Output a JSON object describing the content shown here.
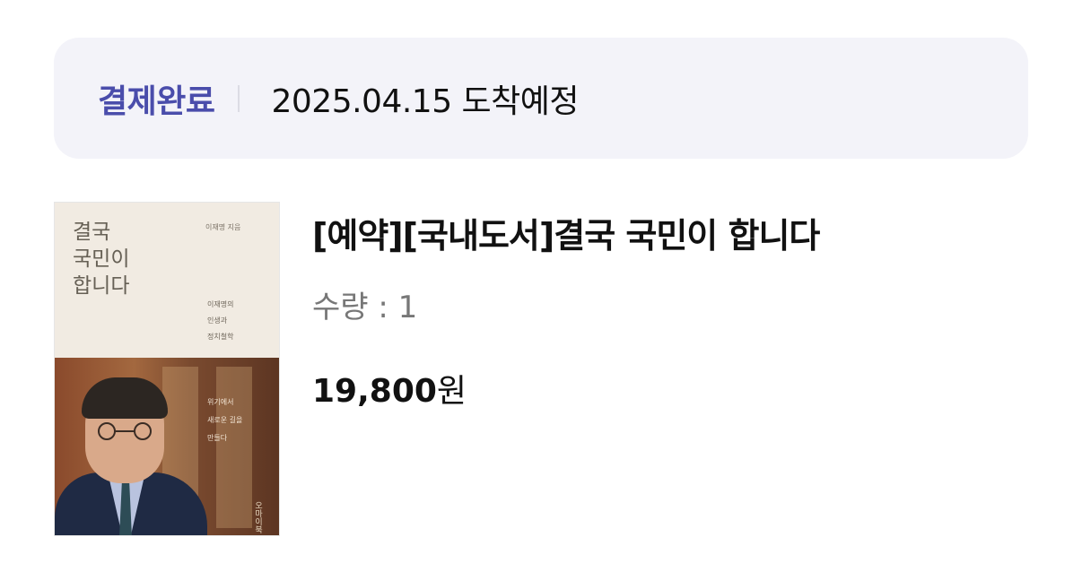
{
  "order_status": {
    "status_label": "결제완료",
    "arrival_text": "2025.04.15 도착예정"
  },
  "item": {
    "title": "[예약][국내도서]결국 국민이 합니다",
    "quantity_label": "수량 : 1",
    "price_amount": "19,800",
    "price_unit": "원",
    "cover": {
      "title": "결국\n국민이\n합니다",
      "author": "이재명 지음",
      "subtitle": "이재명의\n인생과\n정치철학",
      "photo_caption": "위기에서\n새로운 길을\n만들다",
      "publisher_mark": "오마이북"
    }
  },
  "colors": {
    "status_accent": "#4a4dab",
    "status_bg": "#f3f3f9"
  }
}
